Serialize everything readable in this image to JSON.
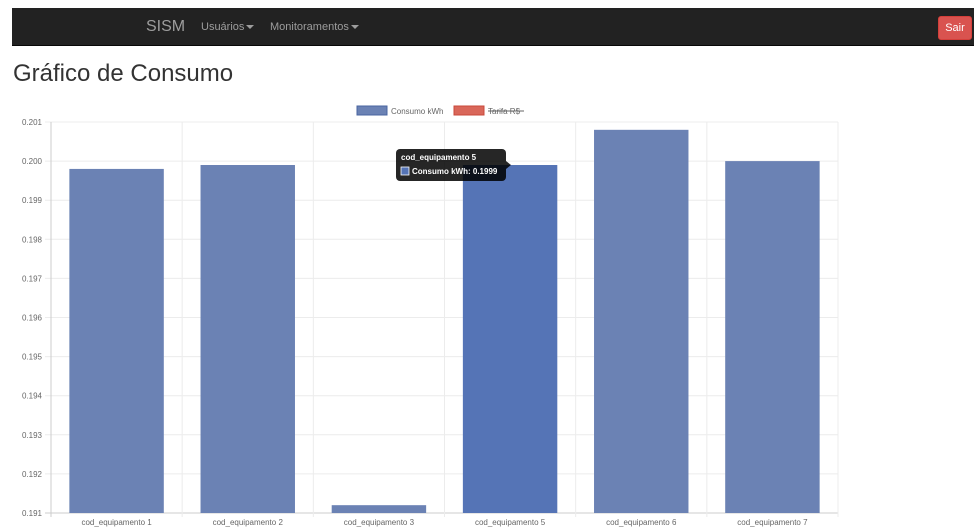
{
  "navbar": {
    "brand": "SISM",
    "menu_users": "Usuários",
    "menu_monitoring": "Monitoramentos",
    "logout": "Sair"
  },
  "page": {
    "title": "Gráfico de Consumo"
  },
  "colors": {
    "navbar_bg": "#222222",
    "logout_bg": "#d9534f",
    "bar": "#6b82b4",
    "bar_hover": "#5574b6",
    "tarifa_legend": "#d9675a"
  },
  "chart_data": {
    "type": "bar",
    "categories": [
      "cod_equipamento 1",
      "cod_equipamento 2",
      "cod_equipamento 3",
      "cod_equipamento 5",
      "cod_equipamento 6",
      "cod_equipamento 7"
    ],
    "series": [
      {
        "name": "Consumo kWh",
        "values": [
          0.1998,
          0.1999,
          0.1912,
          0.1999,
          0.2008,
          0.2
        ]
      },
      {
        "name": "Tarifa R$",
        "values": [],
        "hidden": true
      }
    ],
    "ylim": [
      0.191,
      0.201
    ],
    "yticks": [
      "0.201",
      "0.200",
      "0.199",
      "0.198",
      "0.197",
      "0.196",
      "0.195",
      "0.194",
      "0.193",
      "0.192",
      "0.191"
    ],
    "grid": true,
    "legend": "top-center",
    "tooltip": {
      "title": "cod_equipamento 5",
      "label": "Consumo kWh: 0.1999",
      "category_index": 3
    }
  }
}
